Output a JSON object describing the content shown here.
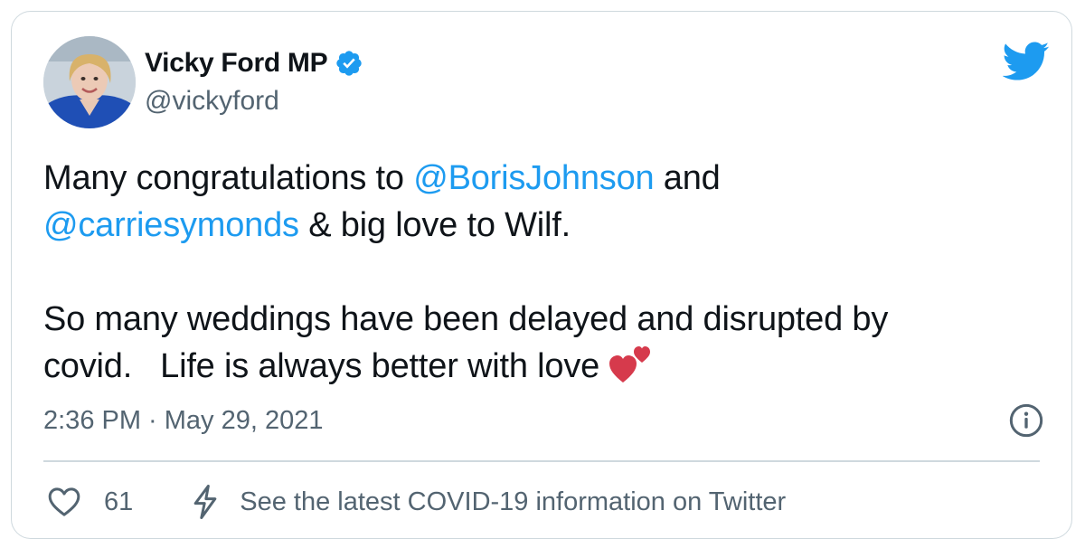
{
  "author": {
    "display_name": "Vicky Ford MP",
    "handle": "@vickyford",
    "verified": true
  },
  "tweet": {
    "line1_prefix": "Many congratulations to ",
    "mention1": "@BorisJohnson",
    "line1_suffix": " and",
    "mention2": "@carriesymonds",
    "line2_suffix": " & big love to Wilf.",
    "para2_line1": "So many weddings have been delayed and disrupted by",
    "para2_line2": "covid.   Life is always better with love ",
    "emoji": "two-hearts"
  },
  "meta": {
    "timestamp": "2:36 PM · May 29, 2021"
  },
  "actions": {
    "like_count": "61",
    "covid_info": "See the latest COVID-19 information on Twitter"
  },
  "colors": {
    "link": "#1d9bf0",
    "text": "#0f1419",
    "secondary": "#536471",
    "border": "#cfd9de",
    "heart": "#d63a4c"
  },
  "icons": {
    "brand": "twitter-bird-icon",
    "verified": "verified-badge-icon",
    "info": "info-icon",
    "like": "heart-outline-icon",
    "covid": "lightning-bolt-icon"
  }
}
